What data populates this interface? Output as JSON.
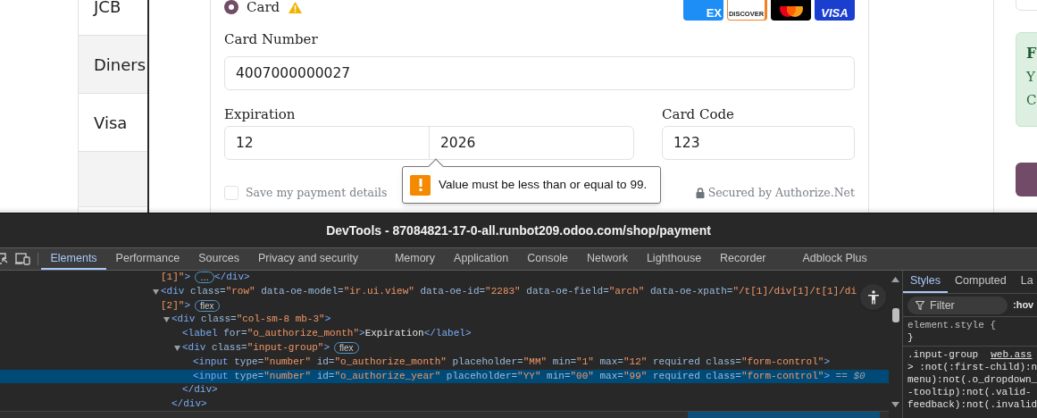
{
  "page": {
    "payment_methods": [
      {
        "label": "JCB"
      },
      {
        "label": "Diners"
      },
      {
        "label": "Visa"
      }
    ],
    "card_option": {
      "label": "Card",
      "selected": true
    },
    "card_brands": [
      {
        "kind": "amex",
        "text": "EX"
      },
      {
        "kind": "discover",
        "text": "DISCOVER"
      },
      {
        "kind": "mastercard"
      },
      {
        "kind": "visa",
        "text": "VISA"
      }
    ],
    "card_number": {
      "label": "Card Number",
      "value": "4007000000027"
    },
    "expiration": {
      "label": "Expiration",
      "month": "12",
      "year": "2026"
    },
    "card_code": {
      "label": "Card Code",
      "value": "123"
    },
    "validation_tooltip": "Value must be less than or equal to 99.",
    "save_details": {
      "label": "Save my payment details",
      "checked": false
    },
    "secured_note": "Secured by Authorize.Net",
    "side_alert": {
      "title": "F",
      "lines": [
        "Y",
        "C"
      ]
    }
  },
  "devtools": {
    "title": "DevTools - 87084821-17-0-all.runbot209.odoo.com/shop/payment",
    "tabs": [
      {
        "label": "Elements",
        "selected": true
      },
      {
        "label": "Performance",
        "selected": false
      },
      {
        "label": "Sources",
        "selected": false
      },
      {
        "label": "Privacy and security",
        "selected": false
      },
      {
        "label": "Memory",
        "selected": false
      },
      {
        "label": "Application",
        "selected": false
      },
      {
        "label": "Console",
        "selected": false
      },
      {
        "label": "Network",
        "selected": false
      },
      {
        "label": "Lighthouse",
        "selected": false
      },
      {
        "label": "Recorder",
        "selected": false
      },
      {
        "label": "Adblock Plus",
        "selected": false
      }
    ],
    "dom_tree": [
      {
        "selected": false,
        "tokens": [
          {
            "kind": "value",
            "text": "[1]\""
          },
          {
            "kind": "tag",
            "text": ">"
          }
        ],
        "badge": "…",
        "tail": [
          {
            "kind": "tag",
            "text": "</div>"
          }
        ]
      },
      {
        "selected": false,
        "expanded": true,
        "tokens": [
          {
            "kind": "tag",
            "text": "<div"
          },
          {
            "kind": "attr",
            "text": " class="
          },
          {
            "kind": "value",
            "text": "\"row\""
          },
          {
            "kind": "attr",
            "text": " data-oe-model="
          },
          {
            "kind": "value",
            "text": "\"ir.ui.view\""
          },
          {
            "kind": "attr",
            "text": " data-oe-id="
          },
          {
            "kind": "value",
            "text": "\"2283\""
          },
          {
            "kind": "attr",
            "text": " data-oe-field="
          },
          {
            "kind": "value",
            "text": "\"arch\""
          },
          {
            "kind": "attr",
            "text": " data-oe-xpath="
          },
          {
            "kind": "value",
            "text": "\"/t[1]/div[1]/t[1]/di"
          }
        ],
        "wrap": {
          "tokens": [
            {
              "kind": "value",
              "text": "[2]\""
            },
            {
              "kind": "tag",
              "text": ">"
            }
          ],
          "badge": "flex"
        },
        "children": [
          {
            "selected": false,
            "expanded": true,
            "tokens": [
              {
                "kind": "tag",
                "text": "<div"
              },
              {
                "kind": "attr",
                "text": " class="
              },
              {
                "kind": "value",
                "text": "\"col-sm-8 mb-3\""
              },
              {
                "kind": "tag",
                "text": ">"
              }
            ],
            "children": [
              {
                "selected": false,
                "tokens": [
                  {
                    "kind": "tag",
                    "text": "<label"
                  },
                  {
                    "kind": "attr",
                    "text": " for="
                  },
                  {
                    "kind": "value",
                    "text": "\"o_authorize_month\""
                  },
                  {
                    "kind": "tag",
                    "text": ">"
                  },
                  {
                    "kind": "text",
                    "text": "Expiration"
                  },
                  {
                    "kind": "tag",
                    "text": "</label>"
                  }
                ]
              },
              {
                "selected": false,
                "expanded": true,
                "tokens": [
                  {
                    "kind": "tag",
                    "text": "<div"
                  },
                  {
                    "kind": "attr",
                    "text": " class="
                  },
                  {
                    "kind": "value",
                    "text": "\"input-group\""
                  },
                  {
                    "kind": "tag",
                    "text": ">"
                  }
                ],
                "badge": "flex",
                "children": [
                  {
                    "selected": false,
                    "tokens": [
                      {
                        "kind": "tag",
                        "text": "<input"
                      },
                      {
                        "kind": "attr",
                        "text": " type="
                      },
                      {
                        "kind": "value",
                        "text": "\"number\""
                      },
                      {
                        "kind": "attr",
                        "text": " id="
                      },
                      {
                        "kind": "value",
                        "text": "\"o_authorize_month\""
                      },
                      {
                        "kind": "attr",
                        "text": " placeholder="
                      },
                      {
                        "kind": "value",
                        "text": "\"MM\""
                      },
                      {
                        "kind": "attr",
                        "text": " min="
                      },
                      {
                        "kind": "value",
                        "text": "\"1\""
                      },
                      {
                        "kind": "attr",
                        "text": " max="
                      },
                      {
                        "kind": "value",
                        "text": "\"12\""
                      },
                      {
                        "kind": "attr",
                        "text": " required"
                      },
                      {
                        "kind": "attr",
                        "text": " class="
                      },
                      {
                        "kind": "value",
                        "text": "\"form-control\""
                      },
                      {
                        "kind": "tag",
                        "text": ">"
                      }
                    ]
                  },
                  {
                    "selected": true,
                    "tokens": [
                      {
                        "kind": "tag",
                        "text": "<input"
                      },
                      {
                        "kind": "attr",
                        "text": " type="
                      },
                      {
                        "kind": "value",
                        "text": "\"number\""
                      },
                      {
                        "kind": "attr",
                        "text": " id="
                      },
                      {
                        "kind": "value",
                        "text": "\"o_authorize_year\""
                      },
                      {
                        "kind": "attr",
                        "text": " placeholder="
                      },
                      {
                        "kind": "value",
                        "text": "\"YY\""
                      },
                      {
                        "kind": "attr",
                        "text": " min="
                      },
                      {
                        "kind": "value",
                        "text": "\"00\""
                      },
                      {
                        "kind": "attr",
                        "text": " max="
                      },
                      {
                        "kind": "value",
                        "text": "\"99\""
                      },
                      {
                        "kind": "attr",
                        "text": " required"
                      },
                      {
                        "kind": "attr",
                        "text": " class="
                      },
                      {
                        "kind": "value",
                        "text": "\"form-control\""
                      },
                      {
                        "kind": "tag",
                        "text": ">"
                      },
                      {
                        "kind": "note",
                        "text": " == $0"
                      }
                    ]
                  }
                ],
                "close": [
                  {
                    "kind": "tag",
                    "text": "</div>"
                  }
                ]
              }
            ],
            "close": [
              {
                "kind": "tag",
                "text": "</div>"
              }
            ]
          }
        ]
      }
    ],
    "styles": {
      "tabs": [
        {
          "label": "Styles",
          "selected": true
        },
        {
          "label": "Computed",
          "selected": false
        },
        {
          "label": "La",
          "selected": false
        }
      ],
      "filter": {
        "placeholder": "Filter"
      },
      "hov": ":hov",
      "element_style": [
        "element.style {",
        "}"
      ],
      "rule": {
        "selector": ".input-group",
        "source": "web.ass",
        "lines": [
          "> :not(:first-child):n",
          "menu):not(.o_dropdown_",
          "-tooltip):not(.valid-",
          "feedback):not(.invalid"
        ]
      }
    }
  }
}
